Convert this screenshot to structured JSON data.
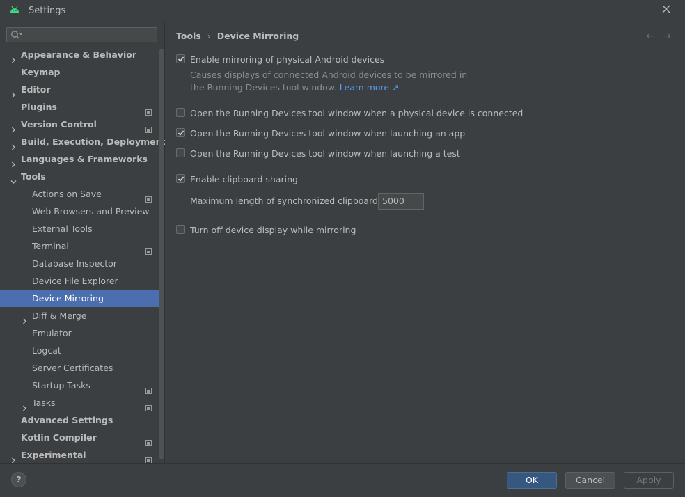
{
  "window": {
    "title": "Settings"
  },
  "search": {
    "placeholder": ""
  },
  "sidebar": {
    "items": [
      {
        "label": "Appearance & Behavior",
        "chevron": "right"
      },
      {
        "label": "Keymap"
      },
      {
        "label": "Editor",
        "chevron": "right"
      },
      {
        "label": "Plugins",
        "project_icon": true
      },
      {
        "label": "Version Control",
        "chevron": "right",
        "project_icon": true
      },
      {
        "label": "Build, Execution, Deployment",
        "chevron": "right"
      },
      {
        "label": "Languages & Frameworks",
        "chevron": "right"
      },
      {
        "label": "Tools",
        "chevron": "down"
      },
      {
        "label": "Actions on Save",
        "project_icon": true
      },
      {
        "label": "Web Browsers and Preview"
      },
      {
        "label": "External Tools"
      },
      {
        "label": "Terminal",
        "project_icon": true
      },
      {
        "label": "Database Inspector"
      },
      {
        "label": "Device File Explorer"
      },
      {
        "label": "Device Mirroring",
        "selected": true
      },
      {
        "label": "Diff & Merge",
        "chevron": "right"
      },
      {
        "label": "Emulator"
      },
      {
        "label": "Logcat"
      },
      {
        "label": "Server Certificates"
      },
      {
        "label": "Startup Tasks",
        "project_icon": true
      },
      {
        "label": "Tasks",
        "chevron": "right",
        "project_icon": true
      },
      {
        "label": "Advanced Settings"
      },
      {
        "label": "Kotlin Compiler",
        "project_icon": true
      },
      {
        "label": "Experimental",
        "chevron": "right",
        "project_icon": true
      }
    ]
  },
  "breadcrumb": {
    "parent": "Tools",
    "current": "Device Mirroring"
  },
  "options": {
    "enable_mirroring": {
      "label": "Enable mirroring of physical Android devices",
      "checked": true
    },
    "mirroring_desc_line1": "Causes displays of connected Android devices to be mirrored in",
    "mirroring_desc_line2": "the Running Devices tool window.",
    "learn_more": "Learn more ↗",
    "open_on_connect": {
      "label": "Open the Running Devices tool window when a physical device is connected",
      "checked": false
    },
    "open_on_launch_app": {
      "label": "Open the Running Devices tool window when launching an app",
      "checked": true
    },
    "open_on_launch_test": {
      "label": "Open the Running Devices tool window when launching a test",
      "checked": false
    },
    "clipboard_sharing": {
      "label": "Enable clipboard sharing",
      "checked": true
    },
    "clipboard_max_label": "Maximum length of synchronized clipboard text:",
    "clipboard_max_value": "5000",
    "turn_off_display": {
      "label": "Turn off device display while mirroring",
      "checked": false
    }
  },
  "footer": {
    "help": "?",
    "ok": "OK",
    "cancel": "Cancel",
    "apply": "Apply"
  },
  "colors": {
    "background": "#3c3f41",
    "selection": "#4b6eaf",
    "primary_button": "#365880",
    "link": "#589df6",
    "android_green": "#3ddc84"
  }
}
